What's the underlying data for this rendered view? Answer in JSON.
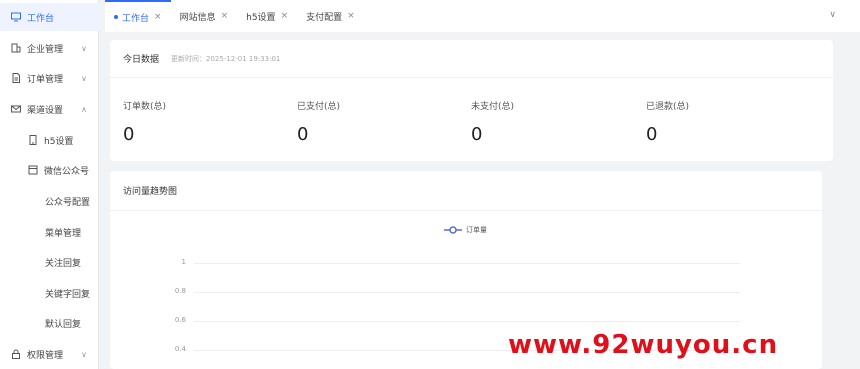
{
  "sidebar": {
    "items": [
      {
        "label": "工作台",
        "icon": "monitor-icon",
        "active": true
      },
      {
        "label": "企业管理",
        "icon": "building-icon",
        "arrow": "∨"
      },
      {
        "label": "订单管理",
        "icon": "document-icon",
        "arrow": "∨"
      },
      {
        "label": "渠道设置",
        "icon": "mail-icon",
        "arrow": "∧"
      },
      {
        "label": "h5设置",
        "icon": "phone-icon"
      },
      {
        "label": "微信公众号",
        "icon": "window-icon"
      },
      {
        "label": "公众号配置"
      },
      {
        "label": "菜单管理"
      },
      {
        "label": "关注回复"
      },
      {
        "label": "关键字回复"
      },
      {
        "label": "默认回复"
      },
      {
        "label": "权限管理",
        "icon": "lock-icon",
        "arrow": "∨"
      }
    ]
  },
  "tabs": [
    {
      "label": "工作台",
      "active": true
    },
    {
      "label": "网站信息"
    },
    {
      "label": "h5设置"
    },
    {
      "label": "支付配置"
    }
  ],
  "today": {
    "title": "今日数据",
    "update_time": "更新时间：2025-12-01 19:33:01",
    "stats": [
      {
        "label": "订单数(总)",
        "value": "0"
      },
      {
        "label": "已支付(总)",
        "value": "0"
      },
      {
        "label": "未支付(总)",
        "value": "0"
      },
      {
        "label": "已退款(总)",
        "value": "0"
      }
    ]
  },
  "chart_data": {
    "type": "line",
    "title": "访问量趋势图",
    "series": [
      {
        "name": "订单量",
        "values": []
      }
    ],
    "y_ticks": [
      "1",
      "0.8",
      "0.6",
      "0.4"
    ],
    "ylim": [
      0,
      1
    ],
    "grid": true,
    "legend": "top-center",
    "color": "#5470c6"
  },
  "watermark": "www.92wuyou.cn",
  "colors": {
    "accent": "#2f6bff",
    "watermark": "#e0101a"
  }
}
